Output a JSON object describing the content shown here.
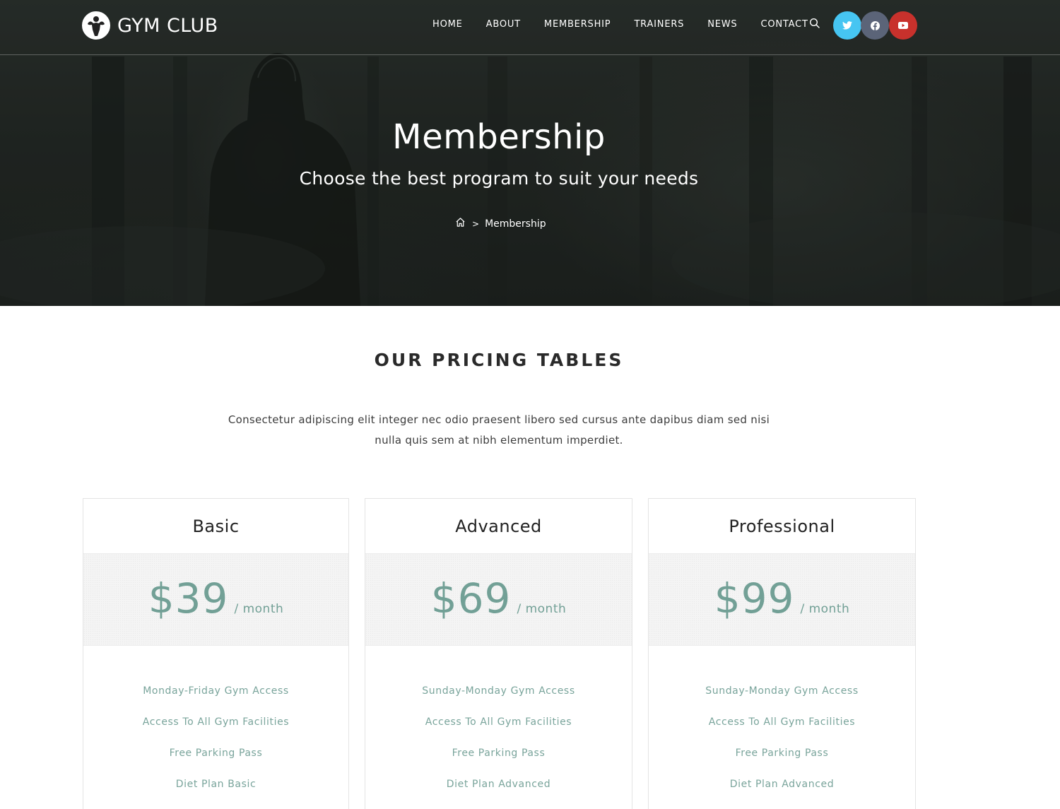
{
  "brand": {
    "name": "GYM CLUB"
  },
  "nav": {
    "items": [
      "HOME",
      "ABOUT",
      "MEMBERSHIP",
      "TRAINERS",
      "NEWS",
      "CONTACT"
    ]
  },
  "social": {
    "twitter_color": "#46c5f2",
    "facebook_color": "#5b6478",
    "youtube_color": "#c8312c"
  },
  "hero": {
    "title": "Membership",
    "subtitle": "Choose the best program to suit your needs",
    "breadcrumb": {
      "separator": ">",
      "current": "Membership"
    }
  },
  "pricing": {
    "heading": "OUR PRICING TABLES",
    "description": "Consectetur adipiscing elit integer nec odio praesent libero sed cursus ante dapibus diam sed nisi nulla quis sem at nibh elementum imperdiet.",
    "accent_color": "#72a096",
    "plans": [
      {
        "name": "Basic",
        "price": "$39",
        "period": "/ month",
        "features": [
          "Monday-Friday Gym Access",
          "Access To All Gym Facilities",
          "Free Parking Pass",
          "Diet Plan Basic"
        ]
      },
      {
        "name": "Advanced",
        "price": "$69",
        "period": "/ month",
        "features": [
          "Sunday-Monday Gym Access",
          "Access To All Gym Facilities",
          "Free Parking Pass",
          "Diet Plan Advanced"
        ]
      },
      {
        "name": "Professional",
        "price": "$99",
        "period": "/ month",
        "features": [
          "Sunday-Monday Gym Access",
          "Access To All Gym Facilities",
          "Free Parking Pass",
          "Diet Plan Advanced"
        ]
      }
    ]
  }
}
